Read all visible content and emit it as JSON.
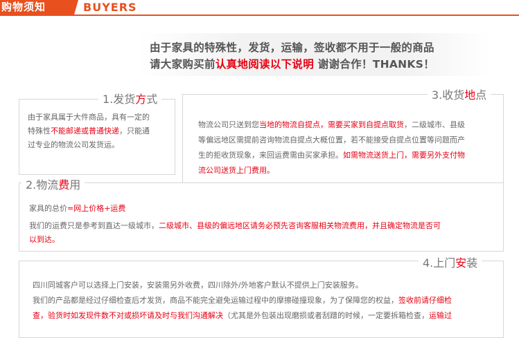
{
  "header": {
    "title_cn": "购物须知",
    "title_en": "BUYERS"
  },
  "notice": {
    "line1": "由于家具的特殊性，发货，运输，签收都不用于一般的商品",
    "line2_pre": "请大家购买前",
    "line2_highlight": "认真地阅读以下说明",
    "line2_post": "  谢谢合作！THANKS！"
  },
  "section1": {
    "title_pre": "1.发货",
    "title_hl": "方",
    "title_post": "式",
    "p1": "由于家具属于大件商品，具有一定的",
    "p2_pre": "特殊性",
    "p2_hl": "不能邮递或普通快递",
    "p2_post": "，只能通",
    "p3": "过专业的物流公司发货运。"
  },
  "section3": {
    "title_pre": "3.收货",
    "title_hl": "地",
    "title_post": "点",
    "l1_pre": "物流公司只送到您",
    "l1_hl": "当地的物流自提点，需要买家到自提点取货",
    "l1_post": "，二级城市、县级",
    "l2": "等偏远地区需提前咨询物流自提点大概位置，若不能接受自提点位置等问题而产",
    "l3_pre": "生的拒收货现象，来回运费需由买家承担。",
    "l3_hl": "如需物流送货上门，需要另外支付物",
    "l4_hl": "流公司送货上门费用。"
  },
  "section2": {
    "title_pre": "2.物流",
    "title_hl": "费",
    "title_post": "用",
    "l1_pre": "家具的总价",
    "l1_hl": "=网上价格+运费",
    "l2_pre": "我们的运费只是参考到直达一级城市，",
    "l2_hl": "二级城市、县级的偏远地区请务必预先咨询客服相关物流费用，并且确定物流是否可",
    "l3_hl": "以到达。"
  },
  "section4": {
    "title_pre": "4.上门",
    "title_hl": "安",
    "title_post": "装",
    "l1": "四川同城客户可以选择上门安装，安装需另外收费，四川除外/外地客户默认不提供上门安装服务。",
    "l2_pre": "我们的产品都是经过仔细检查后才发货，商品不能完全避免运输过程中的摩擦碰撞现象，为了保障您的权益，",
    "l2_hl": "签收前请仔细检",
    "l3_hl": "查，验货时如发现件数不对或损坏请及时与我们沟通解决",
    "l3_mid": "（尤其是外包装出现磨损或者刮蹭的时候，一定要拆箱检查，",
    "l3_hl2": "运输过"
  },
  "colors": {
    "accent": "#e8501e",
    "highlight": "#e60012",
    "text": "#666666",
    "border": "#d6d6d6"
  }
}
